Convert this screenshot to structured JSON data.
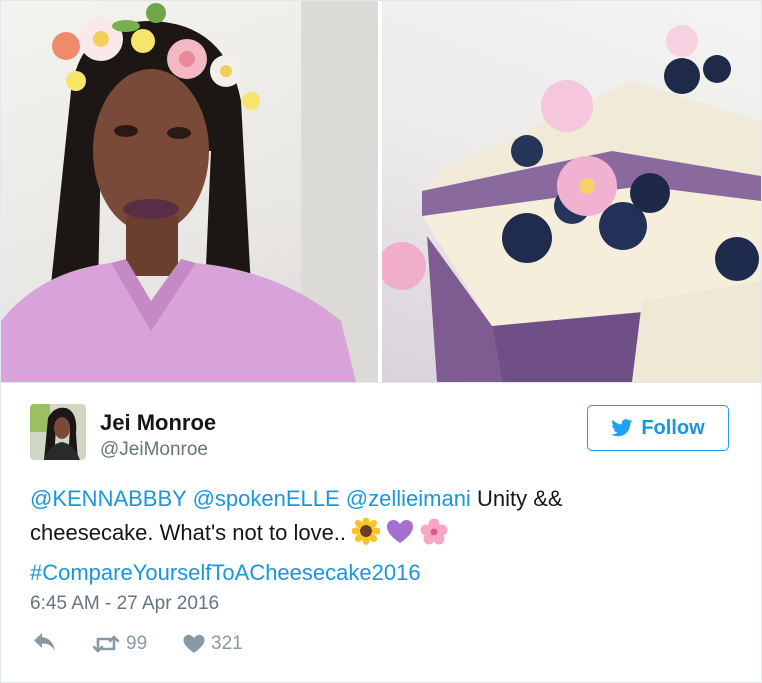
{
  "user": {
    "name": "Jei Monroe",
    "handle": "@JeiMonroe"
  },
  "follow": {
    "label": "Follow",
    "icon": "bird-icon",
    "color": "#1da1f2"
  },
  "tweet": {
    "mention_1": "@KENNABBBY",
    "mention_2": "@spokenELLE",
    "mention_3": "@zellieimani",
    "text_a": "Unity &&",
    "text_b": "cheesecake. What's not to love..",
    "emojis": [
      "sunflower-emoji",
      "purple-heart-emoji",
      "cherry-blossom-emoji"
    ],
    "hashtag": "#CompareYourselfToACheesecake2016"
  },
  "timestamp": "6:45 AM - 27 Apr 2016",
  "actions": {
    "reply_icon": "reply-icon",
    "retweet_icon": "retweet-icon",
    "retweet_count": "99",
    "like_icon": "heart-icon",
    "like_count": "321"
  },
  "colors": {
    "link": "#1b95e0",
    "muted": "#66757f",
    "action": "#8899a6"
  }
}
